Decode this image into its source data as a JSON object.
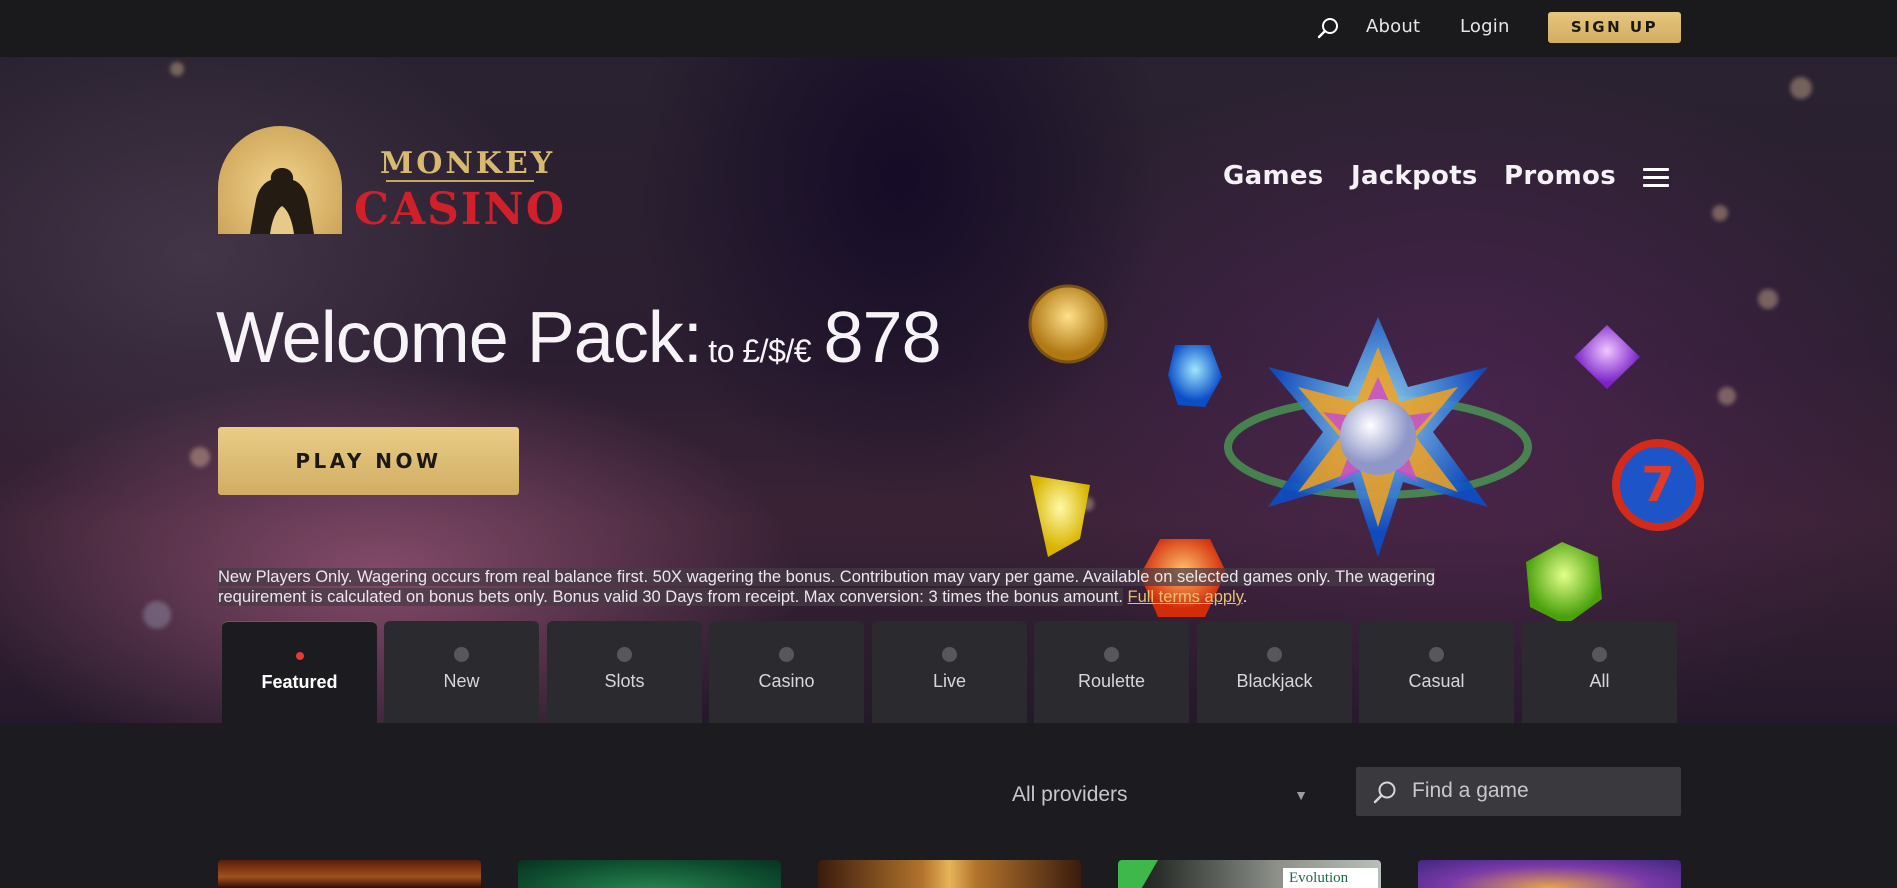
{
  "topbar": {
    "search_icon": "search-icon",
    "about": "About",
    "login": "Login",
    "signup": "SIGN UP"
  },
  "logo": {
    "word1": "MONKEY",
    "word2": "CASINO"
  },
  "nav": {
    "games": "Games",
    "jackpots": "Jackpots",
    "promos": "Promos",
    "menu_icon": "hamburger-menu-icon"
  },
  "hero": {
    "headline_main": "Welcome Pack:",
    "headline_to": "to £/$/€",
    "headline_amount": "878",
    "cta": "PLAY NOW",
    "terms_text": "New Players Only. Wagering occurs from real balance first. 50X wagering the bonus. Contribution may vary per game. Available on selected games only. The wagering requirement is calculated on bonus bets only. Bonus valid 30 Days from receipt. Max conversion: 3 times the bonus amount.",
    "terms_link": "Full terms apply",
    "terms_end": "."
  },
  "tabs": [
    {
      "label": "Featured",
      "active": true
    },
    {
      "label": "New",
      "active": false
    },
    {
      "label": "Slots",
      "active": false
    },
    {
      "label": "Casino",
      "active": false
    },
    {
      "label": "Live",
      "active": false
    },
    {
      "label": "Roulette",
      "active": false
    },
    {
      "label": "Blackjack",
      "active": false
    },
    {
      "label": "Casual",
      "active": false
    },
    {
      "label": "All",
      "active": false
    }
  ],
  "filters": {
    "providers_selected": "All providers",
    "search_placeholder": "Find a game"
  },
  "thumbnails": {
    "thumb4_badge": "Evolution"
  },
  "colors": {
    "gold": "#d9b86f",
    "brand_red": "#d2202b",
    "active_dot": "#e63b30",
    "background": "#1c1b1f"
  }
}
